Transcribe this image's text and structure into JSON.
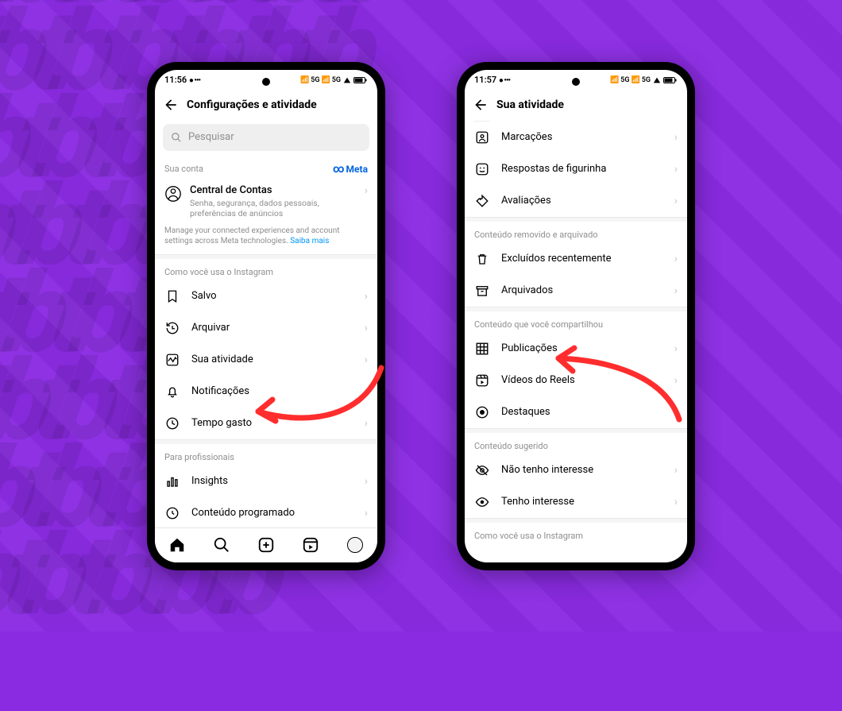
{
  "bg_watermark": "tbtbtbtbtbtb\ntbtbtbtbtbtb\ntbtbtbtbtbtb\ntbtbtbtbtbtb\ntbtbtbtbtbtb\ntbtbtbtbtbtb\ntbtbtbtbtbtb\ntbtbtbtbtbtb",
  "phone1": {
    "status": {
      "time": "11:56",
      "net": "5G",
      "wifi": "5G"
    },
    "header": {
      "title": "Configurações e atividade"
    },
    "search": {
      "placeholder": "Pesquisar"
    },
    "account": {
      "section_label": "Sua conta",
      "meta_label": "Meta",
      "ac_title": "Central de Contas",
      "ac_subtitle": "Senha, segurança, dados pessoais, preferências de anúncios",
      "mgmt_text": "Manage your connected experiences and account settings across Meta technologies.",
      "mgmt_link": "Saiba mais"
    },
    "usage": {
      "section_label": "Como você usa o Instagram",
      "items": [
        {
          "label": "Salvo",
          "icon": "bookmark"
        },
        {
          "label": "Arquivar",
          "icon": "history"
        },
        {
          "label": "Sua atividade",
          "icon": "activity"
        },
        {
          "label": "Notificações",
          "icon": "bell"
        },
        {
          "label": "Tempo gasto",
          "icon": "clock"
        }
      ]
    },
    "pro": {
      "section_label": "Para profissionais",
      "items": [
        {
          "label": "Insights",
          "icon": "bars"
        },
        {
          "label": "Conteúdo programado",
          "icon": "scheduled"
        }
      ]
    }
  },
  "phone2": {
    "status": {
      "time": "11:57",
      "net": "5G",
      "wifi": "5G"
    },
    "header": {
      "title": "Sua atividade"
    },
    "interactions": {
      "items": [
        {
          "label": "Marcações",
          "icon": "tag-person"
        },
        {
          "label": "Respostas de figurinha",
          "icon": "sticker"
        },
        {
          "label": "Avaliações",
          "icon": "price-tag"
        }
      ]
    },
    "removed": {
      "section_label": "Conteúdo removido e arquivado",
      "items": [
        {
          "label": "Excluídos recentemente",
          "icon": "trash"
        },
        {
          "label": "Arquivados",
          "icon": "archive"
        }
      ]
    },
    "shared": {
      "section_label": "Conteúdo que você compartilhou",
      "items": [
        {
          "label": "Publicações",
          "icon": "grid"
        },
        {
          "label": "Vídeos do Reels",
          "icon": "reels"
        },
        {
          "label": "Destaques",
          "icon": "highlight"
        }
      ]
    },
    "suggested": {
      "section_label": "Conteúdo sugerido",
      "items": [
        {
          "label": "Não tenho interesse",
          "icon": "eye-off"
        },
        {
          "label": "Tenho interesse",
          "icon": "eye"
        }
      ]
    },
    "footer_section": "Como você usa o Instagram"
  },
  "colors": {
    "arrow": "#ff2d2d"
  }
}
